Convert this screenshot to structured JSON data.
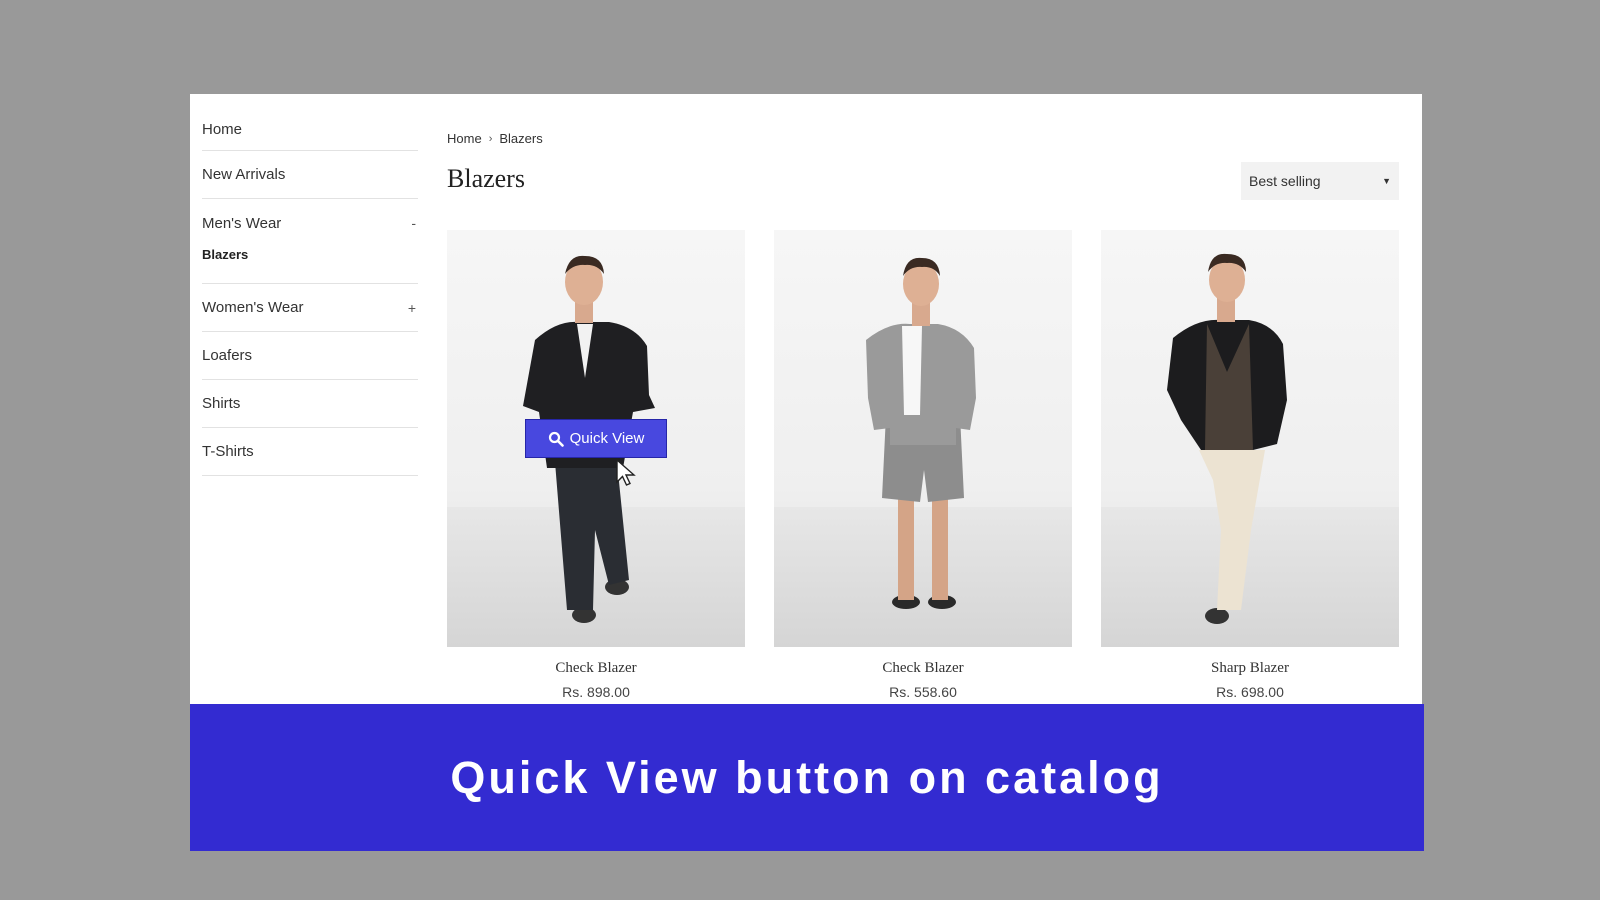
{
  "sidebar": {
    "items": [
      {
        "label": "Home"
      },
      {
        "label": "New Arrivals"
      },
      {
        "label": "Men's Wear",
        "toggle": "-",
        "children": [
          "Blazers"
        ]
      },
      {
        "label": "Women's Wear",
        "toggle": "+"
      },
      {
        "label": "Loafers"
      },
      {
        "label": "Shirts"
      },
      {
        "label": "T-Shirts"
      }
    ]
  },
  "breadcrumb": {
    "home": "Home",
    "separator": "›",
    "current": "Blazers"
  },
  "page_title": "Blazers",
  "sort": {
    "selected": "Best selling"
  },
  "products": [
    {
      "title": "Check Blazer",
      "price": "Rs. 898.00",
      "outfit": "dark-blazer-jeans"
    },
    {
      "title": "Check Blazer",
      "price": "Rs. 558.60",
      "outfit": "grey-check-suit-shorts"
    },
    {
      "title": "Sharp Blazer",
      "price": "Rs. 698.00",
      "outfit": "black-blazer-cream-pants"
    }
  ],
  "quick_view": {
    "label": "Quick View",
    "icon": "search-icon",
    "color": "#4848df"
  },
  "banner": {
    "text": "Quick View button on catalog",
    "color": "#332bd1"
  }
}
